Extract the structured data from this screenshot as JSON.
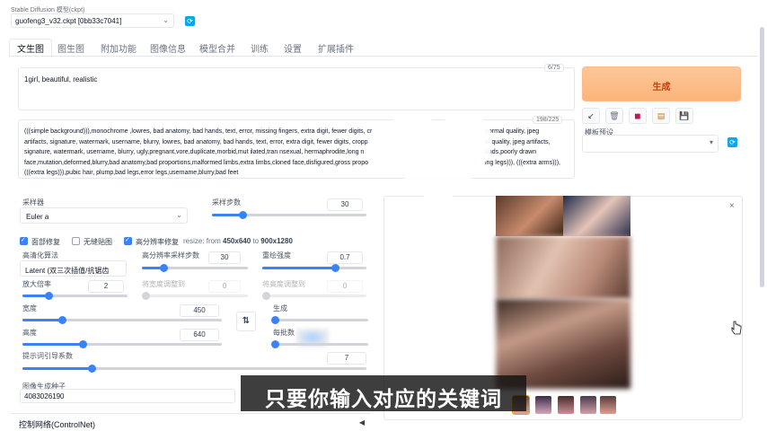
{
  "model": {
    "label": "Stable Diffusion 模型(ckpt)",
    "value": "guofeng3_v32.ckpt [0bb33c7041]"
  },
  "tabs": [
    "文生图",
    "图生图",
    "附加功能",
    "图像信息",
    "模型合并",
    "训练",
    "设置",
    "扩展插件"
  ],
  "prompt": {
    "text": "1girl, beautiful, realistic",
    "count": "6/75"
  },
  "negative": {
    "line1": "(((simple background))),monochrome ,lowres, bad anatomy, bad hands, text, error, missing fingers, extra digit, fewer digits, cr",
    "line1b": "normal quality, jpeg",
    "line2": "artifacts, signature, watermark, username, blurry, lowres, bad anatomy, bad hands, text, error, extra digit, fewer digits, cropp",
    "line2b": "al quality, jpeg artifacts,",
    "line3": "signature, watermark, username, blurry, ugly,pregnant,vore,duplicate,morbid,mut ilated,tran nsexual, hermaphrodite,long n",
    "line3b": "ands,poorly drawn",
    "line4": "face,mutation,deformed,blurry,bad anatomy,bad proportions,malformed limbs,extra limbs,cloned face,disfigured,gross propo",
    "line4b": "ing legs))), (((extra arms))),",
    "line5": "(((extra legs))),pubic hair, plump,bad legs,error legs,username,blurry,bad feet",
    "count": "198/225"
  },
  "generate_label": "生成",
  "style": {
    "label": "模板预设"
  },
  "sampler": {
    "label": "采样器",
    "value": "Euler a"
  },
  "steps": {
    "label": "采样步数",
    "value": "30",
    "fraction": 0.2
  },
  "checks": {
    "face": "面部修复",
    "tiling": "无缝贴图",
    "hires": "高分辨率修复",
    "resize_prefix": "resize: from ",
    "resize_from": "450x640",
    "resize_to_word": " to ",
    "resize_to": "900x1280"
  },
  "hires": {
    "upscaler_label": "高清化算法",
    "upscaler_value": "Latent (双三次插值/抗锯齿",
    "steps_label": "高分辨率采样步数",
    "steps_value": "30",
    "steps_fraction": 0.2,
    "denoise_label": "重绘强度",
    "denoise_value": "0.7",
    "denoise_fraction": 0.7,
    "scale_label": "放大倍率",
    "scale_value": "2",
    "scale_fraction": 0.25,
    "resize_w_label": "将宽度调整到",
    "resize_w_value": "0",
    "resize_h_label": "将高度调整到",
    "resize_h_value": "0"
  },
  "width": {
    "label": "宽度",
    "value": "450",
    "fraction": 0.2
  },
  "height": {
    "label": "高度",
    "value": "640",
    "fraction": 0.3
  },
  "batch_count_label": "生成",
  "batch_size_label": "每批数",
  "cfg": {
    "label": "提示词引导系数",
    "value": "7",
    "fraction": 0.2
  },
  "seed": {
    "label": "图像生成种子",
    "value": "4083026190"
  },
  "controlnet_label": "控制网络(ControlNet)",
  "subtitle": "只要你输入对应的关键词",
  "colors": {
    "accent": "#3b82f6",
    "generate_bg": "#fbbf88",
    "generate_text": "#c2410c"
  }
}
